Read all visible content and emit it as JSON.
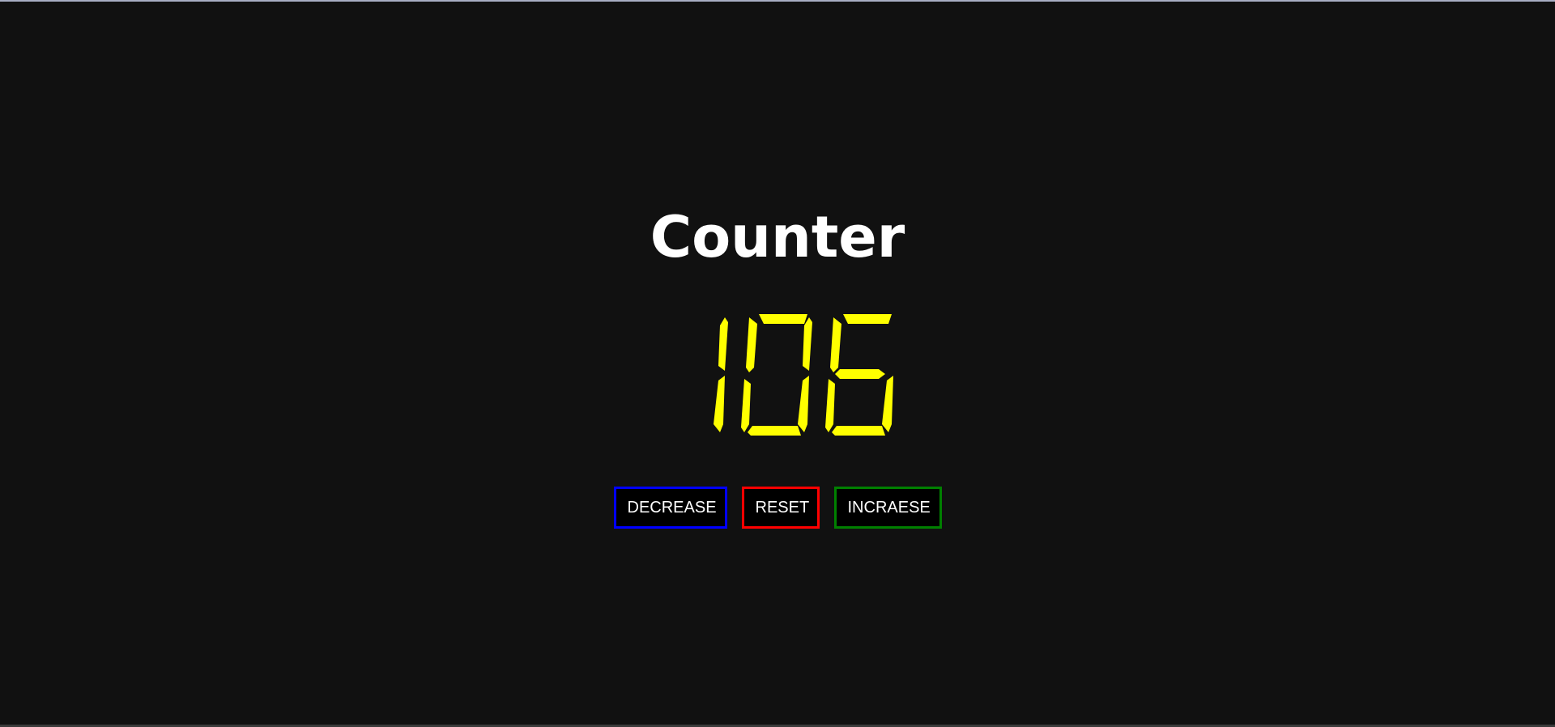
{
  "title": "Counter",
  "counter": {
    "value": "106",
    "digit_color": "#ffff00"
  },
  "buttons": {
    "decrease_label": "DECREASE",
    "reset_label": "RESET",
    "increase_label": "INCRAESE",
    "decrease_color": "#0000ff",
    "reset_color": "#ff0000",
    "increase_color": "#008000"
  },
  "background_color": "#111111"
}
